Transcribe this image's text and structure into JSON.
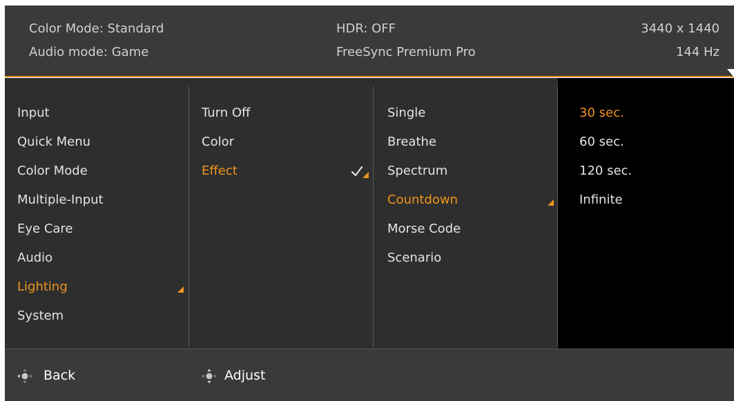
{
  "header": {
    "color_mode": "Color Mode: Standard",
    "audio_mode": "Audio mode: Game",
    "hdr": "HDR: OFF",
    "freesync": "FreeSync Premium Pro",
    "resolution": "3440 x 1440",
    "refresh": "144 Hz"
  },
  "main_menu": {
    "items": [
      "Input",
      "Quick Menu",
      "Color Mode",
      "Multiple-Input",
      "Eye Care",
      "Audio",
      "Lighting",
      "System"
    ],
    "selected": "Lighting"
  },
  "lighting_menu": {
    "items": [
      "Turn Off",
      "Color",
      "Effect"
    ],
    "selected": "Effect"
  },
  "effect_menu": {
    "items": [
      "Single",
      "Breathe",
      "Spectrum",
      "Countdown",
      "Morse Code",
      "Scenario"
    ],
    "selected": "Countdown"
  },
  "countdown_menu": {
    "items": [
      "30 sec.",
      "60 sec.",
      "120 sec.",
      "Infinite"
    ],
    "selected": "30 sec."
  },
  "footer": {
    "back_label": "Back",
    "adjust_label": "Adjust",
    "icon": "joystick-icon"
  },
  "colors": {
    "accent": "#f0951e",
    "header_bg": "#3a3a3a",
    "menu_bg": "#2e2e2e",
    "submenu_bg": "#000000"
  }
}
